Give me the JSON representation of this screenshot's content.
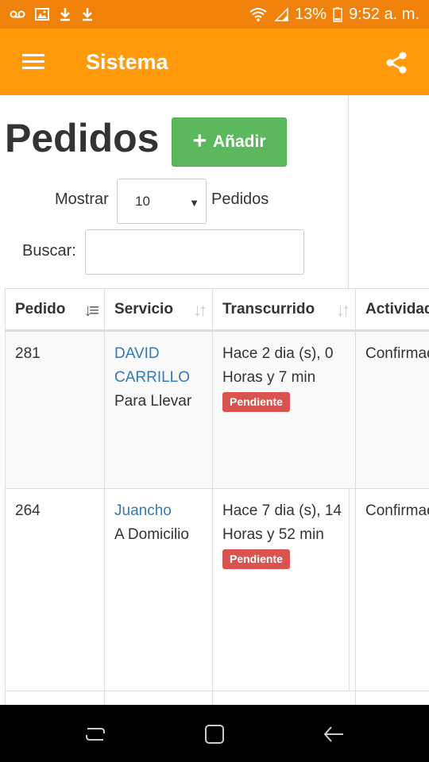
{
  "status_bar": {
    "battery": "13%",
    "time": "9:52 a. m.",
    "icons": [
      "voicemail-icon",
      "image-icon",
      "download-icon",
      "download-icon",
      "wifi-icon",
      "signal-icon",
      "battery-icon"
    ]
  },
  "app_bar": {
    "title": "Sistema",
    "menu_icon": "menu-icon",
    "share_icon": "share-icon"
  },
  "page": {
    "title": "Pedidos",
    "add_button": "Añadir",
    "show_label": "Mostrar",
    "show_value": "10",
    "show_suffix": "Pedidos",
    "search_label": "Buscar:",
    "search_value": ""
  },
  "table": {
    "headers": [
      "Pedido",
      "Servicio",
      "Transcurrido",
      "Actividad"
    ],
    "rows": [
      {
        "pedido": "281",
        "cliente": "DAVID CARRILLO",
        "servicio": "Para Llevar",
        "transcurrido": "Hace 2 dia (s), 0 Horas y 7 min",
        "estado": "Pendiente",
        "actividad": "Confirmado"
      },
      {
        "pedido": "264",
        "cliente": "Juancho",
        "servicio": "A Domicilio",
        "transcurrido": "Hace 7 dia (s), 14 Horas y 52 min",
        "estado": "Pendiente",
        "actividad": "Confirmado"
      }
    ]
  },
  "colors": {
    "status_bar": "#f0810a",
    "app_bar": "#ff9a0a",
    "add_button": "#5cb85c",
    "badge": "#d9534f",
    "link": "#337ab7"
  }
}
